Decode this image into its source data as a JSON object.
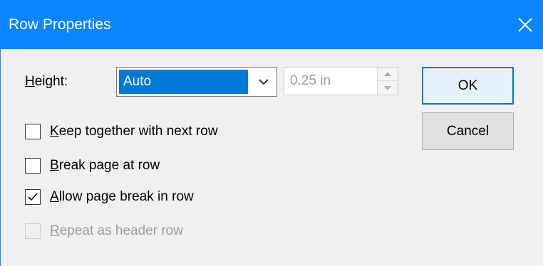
{
  "window": {
    "title": "Row Properties",
    "close_icon": "close-icon",
    "titlebar_color": "#0a84ff"
  },
  "height": {
    "label_accel": "H",
    "label_rest": "eight:",
    "select_value": "Auto",
    "spin_value": "0.25 in",
    "spin_enabled": false
  },
  "checkboxes": [
    {
      "accel": "K",
      "rest": "eep together with next row",
      "checked": false,
      "enabled": true
    },
    {
      "accel": "B",
      "rest": "reak page at row",
      "checked": false,
      "enabled": true
    },
    {
      "accel": "A",
      "rest": "llow page break in row",
      "checked": true,
      "enabled": true
    },
    {
      "accel": "R",
      "rest": "epeat as header row",
      "checked": false,
      "enabled": false
    }
  ],
  "buttons": {
    "ok_label": "OK",
    "cancel_label": "Cancel"
  },
  "colors": {
    "accent": "#0078d7",
    "dialog_bg": "#f0f0f0"
  }
}
